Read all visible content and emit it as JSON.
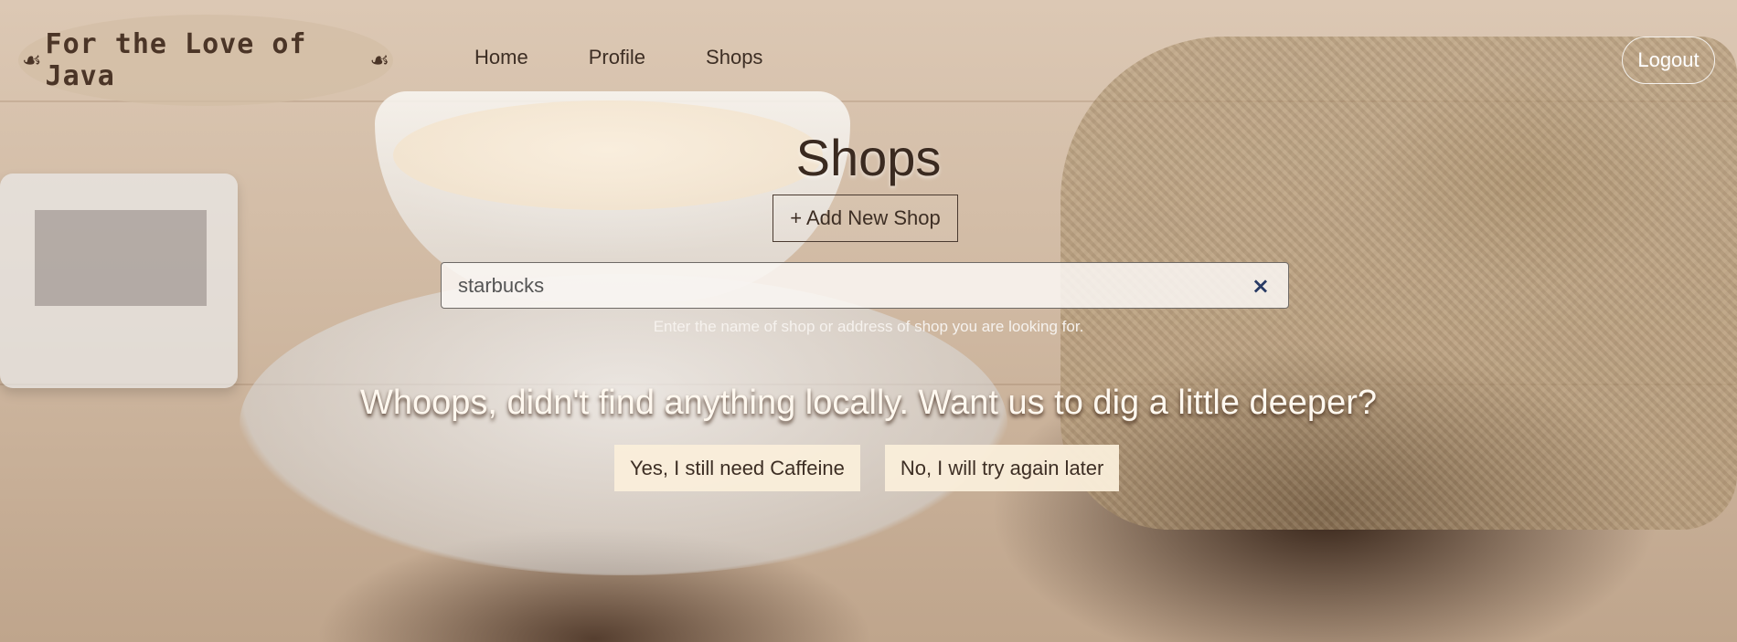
{
  "header": {
    "logo_text": "For the Love of Java",
    "logo_ornament": "☙",
    "nav": [
      {
        "label": "Home"
      },
      {
        "label": "Profile"
      },
      {
        "label": "Shops"
      }
    ],
    "logout_label": "Logout"
  },
  "main": {
    "title": "Shops",
    "add_shop_label": "+ Add New Shop",
    "search": {
      "value": "starbucks",
      "help_text": "Enter the name of shop or address of shop you are looking for.",
      "clear_icon": "×"
    },
    "notice": "Whoops, didn't find anything locally. Want us to dig a little deeper?",
    "actions": {
      "yes_label": "Yes, I still need Caffeine",
      "no_label": "No, I will try again later"
    }
  },
  "colors": {
    "accent_text": "#3d2e24",
    "button_bg": "#faeeda",
    "clear_icon": "#283a64"
  }
}
